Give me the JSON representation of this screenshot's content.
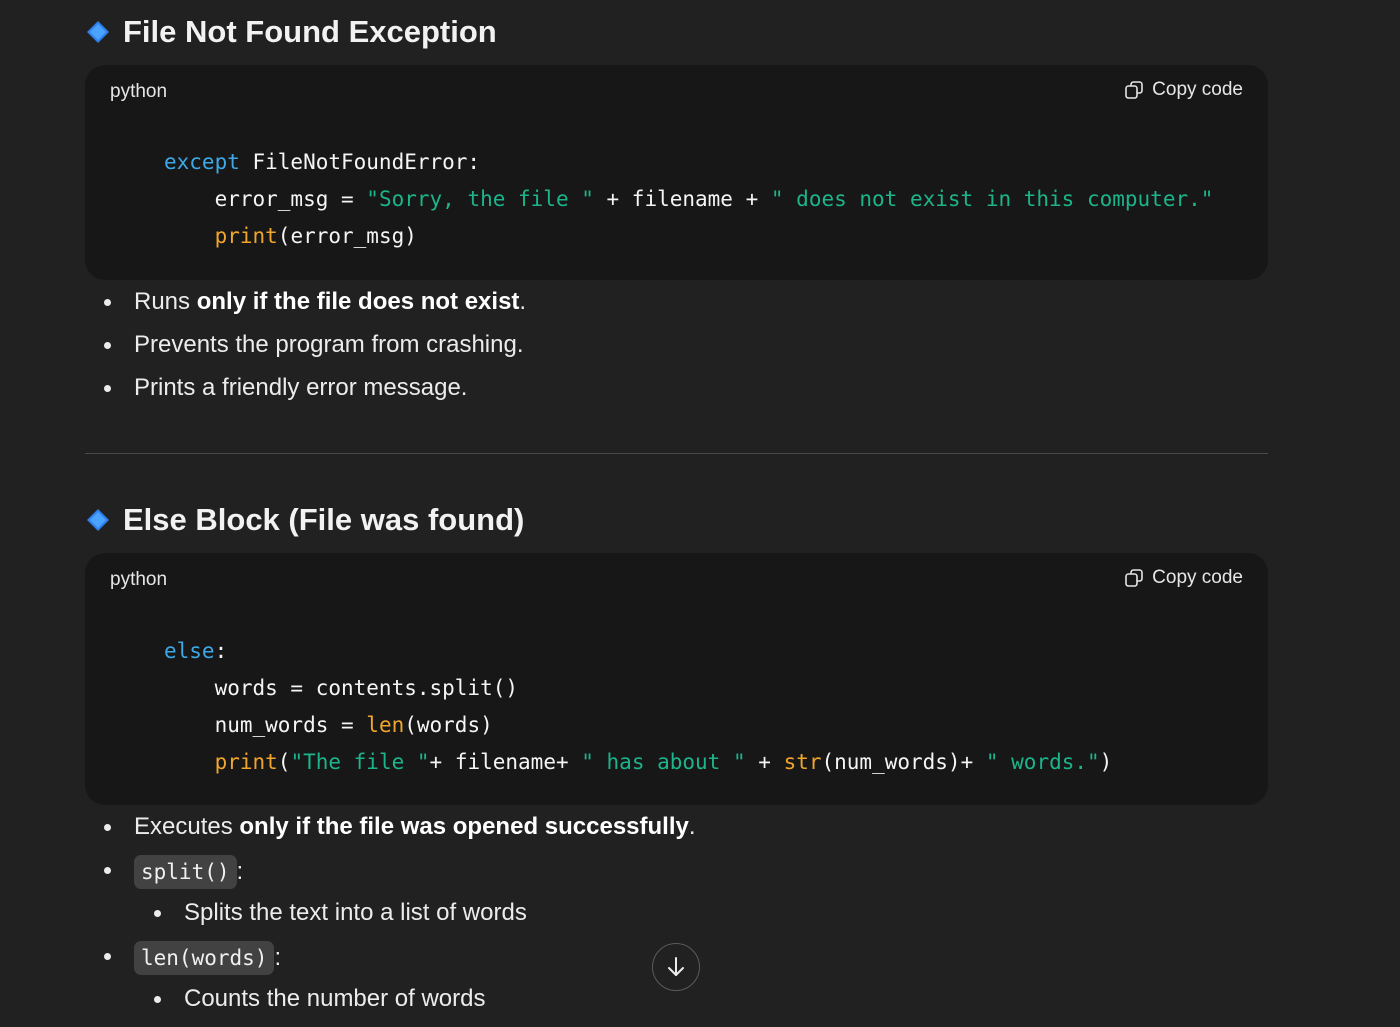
{
  "sections": [
    {
      "title": "File Not Found Exception",
      "code_lang": "python",
      "copy_label": "Copy code",
      "code_lines": [
        [
          {
            "t": "kw",
            "v": "except"
          },
          {
            "t": "p",
            "v": " FileNotFoundError:"
          }
        ],
        [
          {
            "t": "p",
            "v": "    error_msg = "
          },
          {
            "t": "st",
            "v": "\"Sorry, the file \""
          },
          {
            "t": "p",
            "v": " + filename + "
          },
          {
            "t": "st",
            "v": "\" does not exist in this computer.\""
          }
        ],
        [
          {
            "t": "p",
            "v": "    "
          },
          {
            "t": "fn",
            "v": "print"
          },
          {
            "t": "p",
            "v": "(error_msg)"
          }
        ]
      ],
      "bullets": [
        {
          "pre": "Runs ",
          "bold": "only if the file does not exist",
          "post": "."
        },
        {
          "pre": "Prevents the program from crashing.",
          "bold": "",
          "post": ""
        },
        {
          "pre": "Prints a friendly error message.",
          "bold": "",
          "post": ""
        }
      ]
    },
    {
      "title": "Else Block (File was found)",
      "code_lang": "python",
      "copy_label": "Copy code",
      "code_lines": [
        [
          {
            "t": "kw",
            "v": "else"
          },
          {
            "t": "p",
            "v": ":"
          }
        ],
        [
          {
            "t": "p",
            "v": "    words = contents.split()"
          }
        ],
        [
          {
            "t": "p",
            "v": "    num_words = "
          },
          {
            "t": "fn",
            "v": "len"
          },
          {
            "t": "p",
            "v": "(words)"
          }
        ],
        [
          {
            "t": "p",
            "v": "    "
          },
          {
            "t": "fn",
            "v": "print"
          },
          {
            "t": "p",
            "v": "("
          },
          {
            "t": "st",
            "v": "\"The file \""
          },
          {
            "t": "p",
            "v": "+ filename+ "
          },
          {
            "t": "st",
            "v": "\" has about \""
          },
          {
            "t": "p",
            "v": " + "
          },
          {
            "t": "fn",
            "v": "str"
          },
          {
            "t": "p",
            "v": "(num_words)+ "
          },
          {
            "t": "st",
            "v": "\" words.\""
          },
          {
            "t": "p",
            "v": ")"
          }
        ]
      ],
      "bullets": [
        {
          "pre": "Executes ",
          "bold": "only if the file was opened successfully",
          "post": "."
        }
      ],
      "code_bullets": [
        {
          "code": "split()",
          "suffix": ":",
          "sub": "Splits the text into a list of words"
        },
        {
          "code": "len(words)",
          "suffix": ":",
          "sub": "Counts the number of words"
        }
      ]
    }
  ],
  "icons": {
    "section": "blue-diamond-icon",
    "copy": "copy-icon",
    "scroll": "arrow-down-icon"
  },
  "colors": {
    "keyword": "#3ea8e6",
    "function": "#f0a52b",
    "string": "#1cb48a",
    "background": "#212121",
    "code_background": "#171717"
  }
}
